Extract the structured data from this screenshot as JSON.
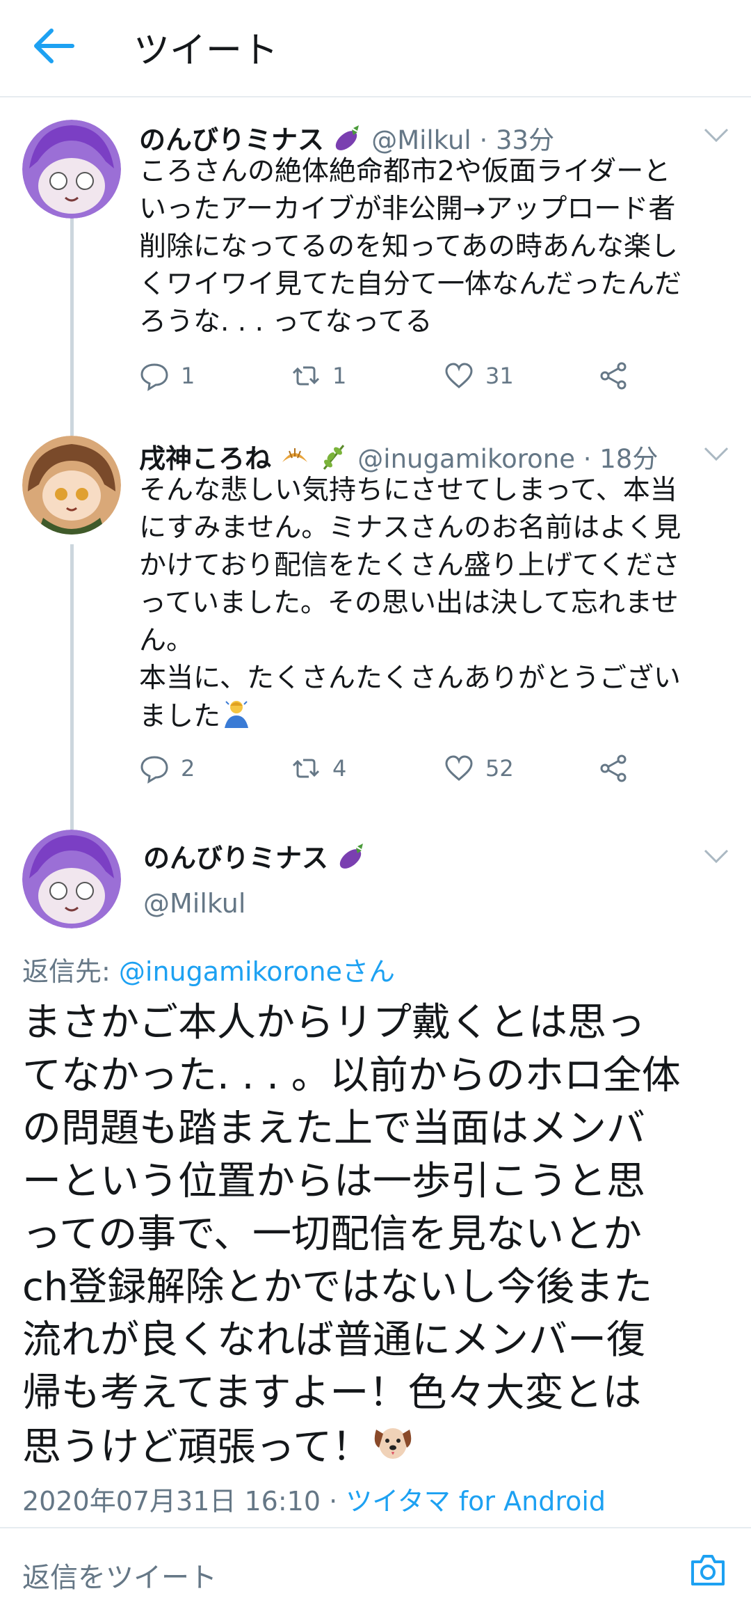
{
  "header": {
    "title": "ツイート"
  },
  "tweets": [
    {
      "name": "のんびりミナス",
      "handle": "@Milkul · 33分",
      "text": "ころさんの絶体絶命都市2や仮面ライダーと\nいったアーカイブが非公開→アップロード者\n削除になってるのを知ってあの時あんな楽し\nくワイワイ見てた自分て一体なんだったんだ\nろうな. . . ってなってる",
      "replies": "1",
      "retweets": "1",
      "likes": "31"
    },
    {
      "name": "戌神ころね",
      "handle": "@inugamikorone · 18分",
      "text": "そんな悲しい気持ちにさせてしまって、本当\nにすみません。ミナスさんのお名前はよく見\nかけており配信をたくさん盛り上げてくださ\nっていました。その思い出は決して忘れませ\nん。\n本当に、たくさんたくさんありがとうござい\nました",
      "replies": "2",
      "retweets": "4",
      "likes": "52"
    }
  ],
  "main_tweet": {
    "name": "のんびりミナス",
    "handle": "@Milkul",
    "reply_label": "返信先: ",
    "reply_target": "@inugamikoroneさん",
    "text": "まさかご本人からリプ戴くとは思っ\nてなかった. . . 。以前からのホロ全体\nの問題も踏まえた上で当面はメンバ\nーという位置からは一歩引こうと思\nっての事で、一切配信を見ないとか\nch登録解除とかではないし今後また\n流れが良くなれば普通にメンバー復\n帰も考えてますよー！色々大変とは\n思うけど頑張って！",
    "timestamp": "2020年07月31日 16:10 · ",
    "source": "ツイタマ for Android"
  },
  "composer": {
    "placeholder": "返信をツイート"
  },
  "colors": {
    "accent": "#1da1f2",
    "secondary": "#657786",
    "divider": "#e6ecf0"
  }
}
